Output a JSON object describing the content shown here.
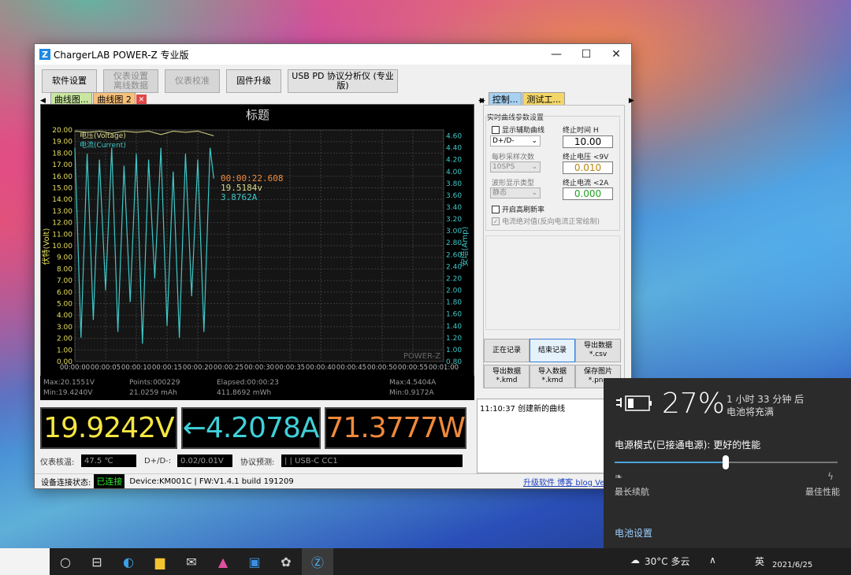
{
  "window": {
    "title": "ChargerLAB POWER-Z 专业版",
    "app_icon": "Z",
    "minimize": "—",
    "maximize": "☐",
    "close": "✕"
  },
  "toolbar": {
    "software_settings": "软件设置",
    "meter_settings": "仪表设置\n离线数据",
    "meter_calibration": "仪表校准",
    "firmware_upgrade": "固件升级",
    "usb_pd_analyzer": "USB PD 协议分析仪 (专业版)"
  },
  "left_tabs": [
    "曲线图...",
    "曲线图 2"
  ],
  "right_tabs": [
    "控制...",
    "测试工..."
  ],
  "chart_data": {
    "type": "line",
    "title": "标题",
    "ylabel_left": "伏特(Volt)",
    "ylabel_right": "安培(Amp)",
    "y_left_ticks": [
      "20.00",
      "19.00",
      "18.00",
      "17.00",
      "16.00",
      "15.00",
      "14.00",
      "13.00",
      "12.00",
      "11.00",
      "10.00",
      "9.00",
      "8.00",
      "7.00",
      "6.00",
      "5.00",
      "4.00",
      "3.00",
      "2.00",
      "1.00",
      "0.00"
    ],
    "y_right_ticks": [
      "4.60",
      "4.40",
      "4.20",
      "4.00",
      "3.80",
      "3.60",
      "3.40",
      "3.20",
      "3.00",
      "2.80",
      "2.60",
      "2.40",
      "2.20",
      "2.00",
      "1.80",
      "1.60",
      "1.40",
      "1.20",
      "1.00",
      "0.80"
    ],
    "x_ticks": [
      "00:00:00",
      "00:00:05",
      "00:00:10",
      "00:00:15",
      "00:00:20",
      "00:00:25",
      "00:00:30",
      "00:00:35",
      "00:00:40",
      "00:00:45",
      "00:00:50",
      "00:00:55",
      "00:01:00"
    ],
    "ylim_left": [
      0,
      20
    ],
    "ylim_right": [
      0.8,
      4.7
    ],
    "xlim_seconds": [
      0,
      60
    ],
    "legend": [
      "电压(Voltage)",
      "电流(Current)"
    ],
    "legend_placement": "top-left",
    "cursor_readout": [
      "00:00:22.608",
      "19.5184v",
      "3.8762A"
    ],
    "watermark": "POWER-Z",
    "series": [
      {
        "name": "电压(Voltage)",
        "color": "#d8d888",
        "x": [
          0,
          2,
          4,
          6,
          8,
          10,
          12,
          14,
          16,
          18,
          20,
          22.6
        ],
        "values": [
          19.9,
          19.8,
          19.9,
          19.7,
          19.9,
          19.8,
          19.9,
          19.6,
          19.9,
          19.8,
          19.9,
          19.5
        ]
      },
      {
        "name": "电流(Current)",
        "color": "#3fc8c8",
        "x": [
          0,
          1,
          2,
          3,
          4,
          5,
          6,
          7,
          8,
          9,
          10,
          11,
          12,
          13,
          14,
          15,
          16,
          17,
          18,
          19,
          20,
          21,
          22,
          22.6
        ],
        "values": [
          4.4,
          1.2,
          4.3,
          1.5,
          4.2,
          2.0,
          4.4,
          1.3,
          4.1,
          1.8,
          4.3,
          1.1,
          4.2,
          2.2,
          4.4,
          1.4,
          4.0,
          1.2,
          4.3,
          1.9,
          4.2,
          1.3,
          4.4,
          3.88
        ]
      }
    ]
  },
  "stats": {
    "max_v": "Max:20.1551V",
    "min_v": "Min:19.4240V",
    "points": "Points:000229",
    "mah": "21.0259 mAh",
    "elapsed": "Elapsed:00:00:23",
    "mwh": "411.8692 mWh",
    "max_a": "Max:4.5404A",
    "min_a": "Min:0.9172A"
  },
  "readouts": {
    "voltage": "19.9242V",
    "current": "←4.2078A",
    "power": "71.3777W",
    "voltage_color": "#f5e642",
    "current_color": "#3fd0d8",
    "power_color": "#f08a3c"
  },
  "info": {
    "temp_label": "仪表核温:",
    "temp_value": "47.5 ℃",
    "dpdm_label": "D+/D-:",
    "dpdm_value": "0.02/0.01V",
    "protocol_label": "协议预测:",
    "protocol_value": "| | USB-C CC1"
  },
  "status": {
    "label": "设备连接状态:",
    "connected": "已连接",
    "device": "Device:KM001C | FW:V1.4.1 build 191209",
    "links": "升级软件 博客 blog Ver:"
  },
  "control": {
    "group_title": "实时曲线参数设置",
    "show_aux": "显示辅助曲线",
    "dpdm_select": "D+/D-",
    "sample_label": "每秒采样次数",
    "sample_value": "10SPS",
    "wave_label": "波形显示类型",
    "wave_value": "静态",
    "high_refresh": "开启高刷新率",
    "abs_current": "电流绝对值(反向电流正常绘制)",
    "end_time_label": "终止时间  H",
    "end_time_value": "10.00",
    "end_voltage_label": "终止电压  <9V",
    "end_voltage_value": "0.010",
    "end_current_label": "终止电流  <2A",
    "end_current_value": "0.000",
    "btn_recording": "正在记录",
    "btn_end_record": "结束记录",
    "btn_export_csv": "导出数据\n*.csv",
    "btn_export_kmd": "导出数据\n*.kmd",
    "btn_import_kmd": "导入数据\n*.kmd",
    "btn_save_png": "保存图片\n*.png"
  },
  "log": {
    "entry": "11:10:37 创建新的曲线"
  },
  "battery": {
    "percent": "27%",
    "remaining": "1 小时 33 分钟 后",
    "status": "电池将充满",
    "mode": "电源模式(已接通电源): 更好的性能",
    "left_label": "最长续航",
    "right_label": "最佳性能",
    "settings": "电池设置"
  },
  "taskbar": {
    "weather": "30°C  多云",
    "lang": "英",
    "date": "2021/6/25"
  }
}
